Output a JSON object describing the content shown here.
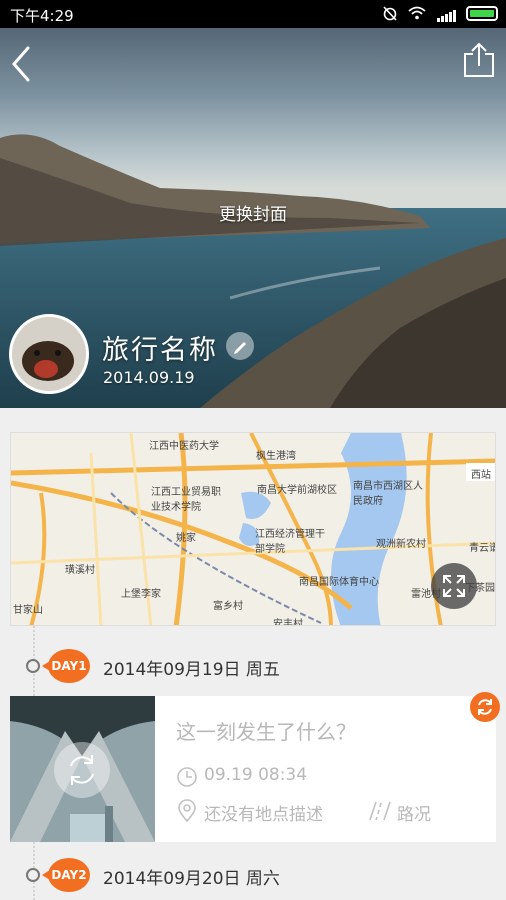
{
  "status_bar": {
    "time": "下午4:29"
  },
  "cover": {
    "change_cover_label": "更换封面",
    "trip_name": "旅行名称",
    "trip_date": "2014.09.19"
  },
  "map": {
    "labels": [
      "江西中医药大学",
      "枫生港湾",
      "南昌市西湖区人民政府",
      "江西工业贸易职业技术学院",
      "南昌大学前湖校区",
      "江西经济管理干部学院",
      "姚家",
      "观洲新农村",
      "青云谱",
      "南昌国际体育中心",
      "上堡李家",
      "富乡村",
      "安丰村",
      "甘家山",
      "璜溪村",
      "雷池村",
      "下茶园",
      "西站"
    ]
  },
  "timeline": {
    "days": [
      {
        "badge": "DAY1",
        "date_text": "2014年09月19日  周五"
      },
      {
        "badge": "DAY2",
        "date_text": "2014年09月20日  周六"
      }
    ],
    "card": {
      "title": "这一刻发生了什么？",
      "time": "09.19  08:34",
      "place": "还没有地点描述",
      "road": "路况"
    }
  },
  "colors": {
    "accent": "#f26e21",
    "battery": "#3fd54b"
  }
}
